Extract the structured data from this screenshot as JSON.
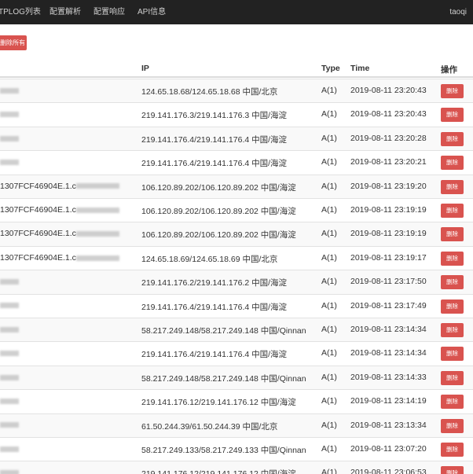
{
  "nav": {
    "items": [
      "TPLOG列表",
      "配置解析",
      "配置响应",
      "API信息"
    ],
    "user": "taoqi"
  },
  "toolbar": {
    "clear_label": "删除所有"
  },
  "table": {
    "headers": {
      "ip": "IP",
      "type": "Type",
      "time": "Time",
      "action": "操作"
    },
    "delete_label": "删除",
    "rows": [
      {
        "host": "",
        "ip": "124.65.18.68/124.65.18.68 中国/北京",
        "type": "A(1)",
        "time": "2019-08-11 23:20:43"
      },
      {
        "host": "",
        "ip": "219.141.176.3/219.141.176.3 中国/海淀",
        "type": "A(1)",
        "time": "2019-08-11 23:20:43"
      },
      {
        "host": "",
        "ip": "219.141.176.4/219.141.176.4 中国/海淀",
        "type": "A(1)",
        "time": "2019-08-11 23:20:28"
      },
      {
        "host": "",
        "ip": "219.141.176.4/219.141.176.4 中国/海淀",
        "type": "A(1)",
        "time": "2019-08-11 23:20:21"
      },
      {
        "host": "1307FCF46904E.1.c",
        "ip": "106.120.89.202/106.120.89.202 中国/海淀",
        "type": "A(1)",
        "time": "2019-08-11 23:19:20"
      },
      {
        "host": "1307FCF46904E.1.c",
        "ip": "106.120.89.202/106.120.89.202 中国/海淀",
        "type": "A(1)",
        "time": "2019-08-11 23:19:19"
      },
      {
        "host": "1307FCF46904E.1.c",
        "ip": "106.120.89.202/106.120.89.202 中国/海淀",
        "type": "A(1)",
        "time": "2019-08-11 23:19:19"
      },
      {
        "host": "1307FCF46904E.1.c",
        "ip": "124.65.18.69/124.65.18.69 中国/北京",
        "type": "A(1)",
        "time": "2019-08-11 23:19:17"
      },
      {
        "host": "",
        "ip": "219.141.176.2/219.141.176.2 中国/海淀",
        "type": "A(1)",
        "time": "2019-08-11 23:17:50"
      },
      {
        "host": "",
        "ip": "219.141.176.4/219.141.176.4 中国/海淀",
        "type": "A(1)",
        "time": "2019-08-11 23:17:49"
      },
      {
        "host": "",
        "ip": "58.217.249.148/58.217.249.148 中国/Qinnan",
        "type": "A(1)",
        "time": "2019-08-11 23:14:34"
      },
      {
        "host": "",
        "ip": "219.141.176.4/219.141.176.4 中国/海淀",
        "type": "A(1)",
        "time": "2019-08-11 23:14:34"
      },
      {
        "host": "",
        "ip": "58.217.249.148/58.217.249.148 中国/Qinnan",
        "type": "A(1)",
        "time": "2019-08-11 23:14:33"
      },
      {
        "host": "",
        "ip": "219.141.176.12/219.141.176.12 中国/海淀",
        "type": "A(1)",
        "time": "2019-08-11 23:14:19"
      },
      {
        "host": "",
        "ip": "61.50.244.39/61.50.244.39 中国/北京",
        "type": "A(1)",
        "time": "2019-08-11 23:13:34"
      },
      {
        "host": "",
        "ip": "58.217.249.133/58.217.249.133 中国/Qinnan",
        "type": "A(1)",
        "time": "2019-08-11 23:07:20"
      },
      {
        "host": "",
        "ip": "219.141.176.12/219.141.176.12 中国/海淀",
        "type": "A(1)",
        "time": "2019-08-11 23:06:53"
      }
    ]
  }
}
